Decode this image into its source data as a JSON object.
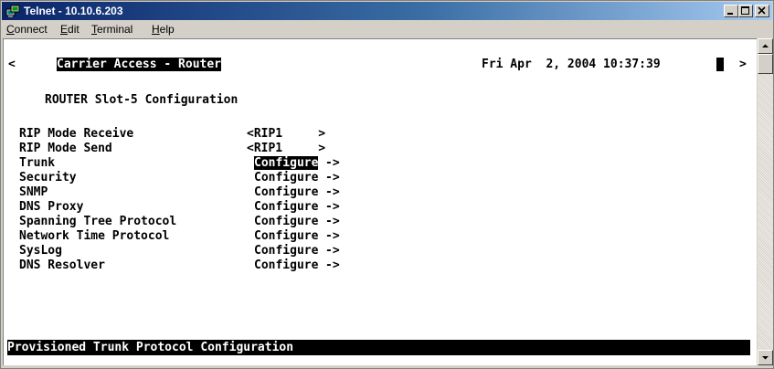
{
  "window": {
    "title": "Telnet - 10.10.6.203",
    "icon": "telnet-app-icon",
    "controls": [
      "minimize-icon",
      "maximize-icon",
      "close-icon"
    ]
  },
  "menu": {
    "items": [
      {
        "underline": "C",
        "rest": "onnect"
      },
      {
        "underline": "E",
        "rest": "dit"
      },
      {
        "underline": "T",
        "rest": "erminal"
      },
      {
        "underline": "H",
        "rest": "elp"
      }
    ]
  },
  "terminal": {
    "nav_left": "<",
    "header": "Carrier Access - Router",
    "datetime": "Fri Apr  2, 2004 10:37:39",
    "nav_right": ">",
    "page_title": "ROUTER Slot-5 Configuration",
    "rows": [
      {
        "label": "RIP Mode Receive",
        "value": "<RIP1     >"
      },
      {
        "label": "RIP Mode Send",
        "value": "<RIP1     >"
      },
      {
        "label": "Trunk",
        "value": "Configure",
        "arrow": "->"
      },
      {
        "label": "Security",
        "value": "Configure",
        "arrow": "->"
      },
      {
        "label": "SNMP",
        "value": "Configure",
        "arrow": "->"
      },
      {
        "label": "DNS Proxy",
        "value": "Configure",
        "arrow": "->"
      },
      {
        "label": "Spanning Tree Protocol",
        "value": "Configure",
        "arrow": "->"
      },
      {
        "label": "Network Time Protocol",
        "value": "Configure",
        "arrow": "->"
      },
      {
        "label": "SysLog",
        "value": "Configure",
        "arrow": "->"
      },
      {
        "label": "DNS Resolver",
        "value": "Configure",
        "arrow": "->"
      }
    ],
    "status": "Provisioned Trunk Protocol Configuration"
  },
  "scrollbar": {
    "up": "scroll-up-arrow-icon",
    "down": "scroll-down-arrow-icon"
  },
  "colors": {
    "titlebar": "#0a246a",
    "terminal_bg": "#ffffff",
    "terminal_fg": "#000000",
    "highlight_bg": "#000000"
  }
}
